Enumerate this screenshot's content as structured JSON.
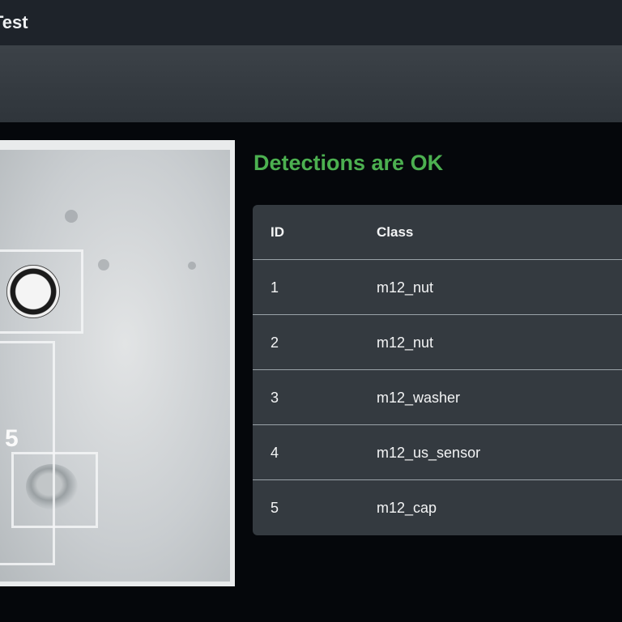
{
  "header": {
    "title": "Test"
  },
  "status": {
    "text": "Detections are OK",
    "color": "#4cb050"
  },
  "image_panel": {
    "box_label": "5",
    "icon": "camera-feed"
  },
  "table": {
    "columns": [
      "ID",
      "Class"
    ],
    "rows": [
      {
        "id": "1",
        "class": "m12_nut"
      },
      {
        "id": "2",
        "class": "m12_nut"
      },
      {
        "id": "3",
        "class": "m12_washer"
      },
      {
        "id": "4",
        "class": "m12_us_sensor"
      },
      {
        "id": "5",
        "class": "m12_cap"
      }
    ]
  }
}
